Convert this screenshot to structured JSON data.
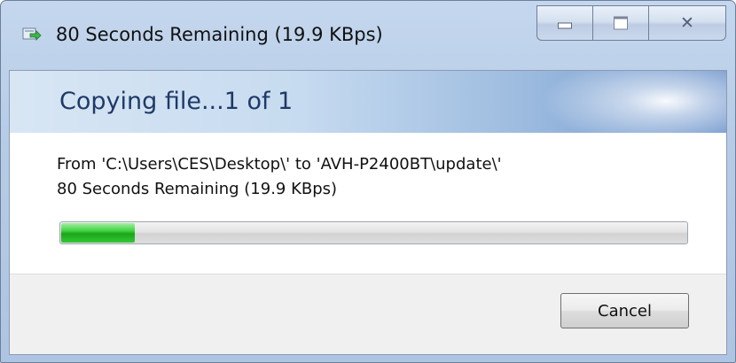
{
  "window": {
    "title": "80 Seconds Remaining (19.9 KBps)",
    "title_icon": "copy-files-icon",
    "buttons": {
      "minimize_icon": "minimize-icon",
      "maximize_icon": "maximize-icon",
      "close_icon": "close-icon",
      "close_glyph": "✕"
    }
  },
  "dialog": {
    "heading": "Copying file...1 of 1",
    "from_line": "From 'C:\\Users\\CES\\Desktop\\' to 'AVH-P2400BT\\update\\'",
    "remaining_line": "80 Seconds Remaining (19.9 KBps)",
    "progress_fraction": 0.12,
    "cancel_label": "Cancel"
  },
  "colors": {
    "progress_green": "#1aa51a",
    "heading_blue": "#1e3a66"
  }
}
